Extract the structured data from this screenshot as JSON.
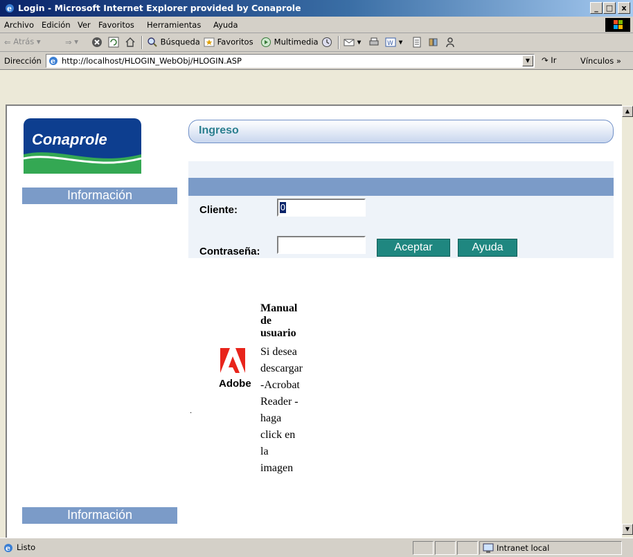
{
  "window": {
    "title": "Login - Microsoft Internet Explorer provided by Conaprole",
    "controls": {
      "minimize": "_",
      "maximize": "□",
      "close": "x"
    }
  },
  "menu": {
    "items": [
      "Archivo",
      "Edición",
      "Ver",
      "Favoritos",
      "Herramientas",
      "Ayuda"
    ]
  },
  "toolbar": {
    "back_label": "Atrás",
    "search_label": "Búsqueda",
    "favorites_label": "Favoritos",
    "multimedia_label": "Multimedia"
  },
  "address": {
    "label": "Dirección",
    "url": "http://localhost/HLOGIN_WebObj/HLOGIN.ASP",
    "go_label": "Ir",
    "links_label": "Vínculos"
  },
  "page": {
    "logo_text": "Conaprole",
    "sidebar_top_label": "Información",
    "sidebar_bottom_label": "Información",
    "section_title": "Ingreso",
    "form": {
      "client_label": "Cliente:",
      "client_value": "0",
      "password_label": "Contraseña:",
      "password_value": "",
      "accept_label": "Aceptar",
      "help_label": "Ayuda"
    },
    "manual_title": "Manual de usuario",
    "adobe_logo_text": "Adobe",
    "download_line1": "Si desea descargar -Acrobat Reader -",
    "download_line2": "haga click en la imagen",
    "stray_dot": "."
  },
  "status": {
    "text": "Listo",
    "zone": "Intranet local"
  },
  "colors": {
    "title_gradient_start": "#0a246a",
    "sidebar_bar": "#7b9bc8",
    "button_teal": "#1f8780",
    "ingreso_text": "#2b7f8f",
    "logo_blue": "#0d3e8f",
    "logo_green": "#34a853",
    "adobe_red": "#e8241b"
  }
}
